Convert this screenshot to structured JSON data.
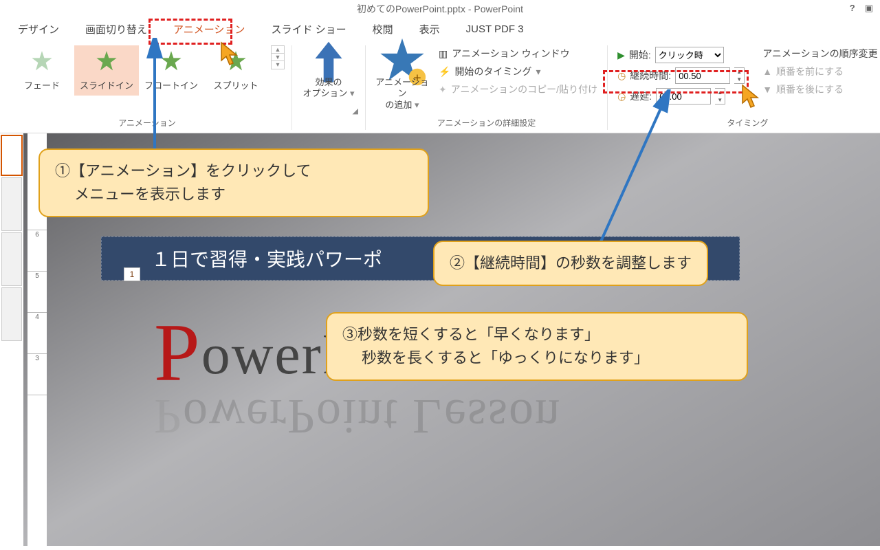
{
  "title": "初めてのPowerPoint.pptx - PowerPoint",
  "tabs": [
    "デザイン",
    "画面切り替え",
    "アニメーション",
    "スライド ショー",
    "校閲",
    "表示",
    "JUST PDF 3"
  ],
  "active_tab_index": 2,
  "anim_gallery": {
    "items": [
      {
        "label": "フェード",
        "fill": "#b6d6b6"
      },
      {
        "label": "スライドイン",
        "fill": "#6aa84f"
      },
      {
        "label": "フロートイン",
        "fill": "#6aa84f"
      },
      {
        "label": "スプリット",
        "fill": "#6aa84f"
      }
    ],
    "active_index": 1,
    "group_label": "アニメーション"
  },
  "effect_options": {
    "label": "効果の\nオプション"
  },
  "add_anim": {
    "label": "アニメーション\nの追加"
  },
  "advanced": {
    "pane": "アニメーション ウィンドウ",
    "trigger": "開始のタイミング",
    "painter": "アニメーションのコピー/貼り付け",
    "group_label": "アニメーションの詳細設定"
  },
  "timing": {
    "start_label": "開始:",
    "start_value": "クリック時",
    "duration_label": "継続時間:",
    "duration_value": "00.50",
    "delay_label": "遅延:",
    "delay_value": "00.00",
    "group_label": "タイミング"
  },
  "reorder": {
    "title": "アニメーションの順序変更",
    "earlier": "順番を前にする",
    "later": "順番を後にする"
  },
  "slide": {
    "title": "１日で習得・実践パワーポ",
    "idx": "1",
    "wordart_main": "owerP",
    "wordart_refl": "owerPoint  Lesson"
  },
  "callouts": {
    "c1_a": "①【アニメーション】をクリックして",
    "c1_b": "メニューを表示します",
    "c2": "②【継続時間】の秒数を調整します",
    "c3_a": "③秒数を短くすると「早くなります」",
    "c3_b": "秒数を長くすると「ゆっくりになります」"
  }
}
